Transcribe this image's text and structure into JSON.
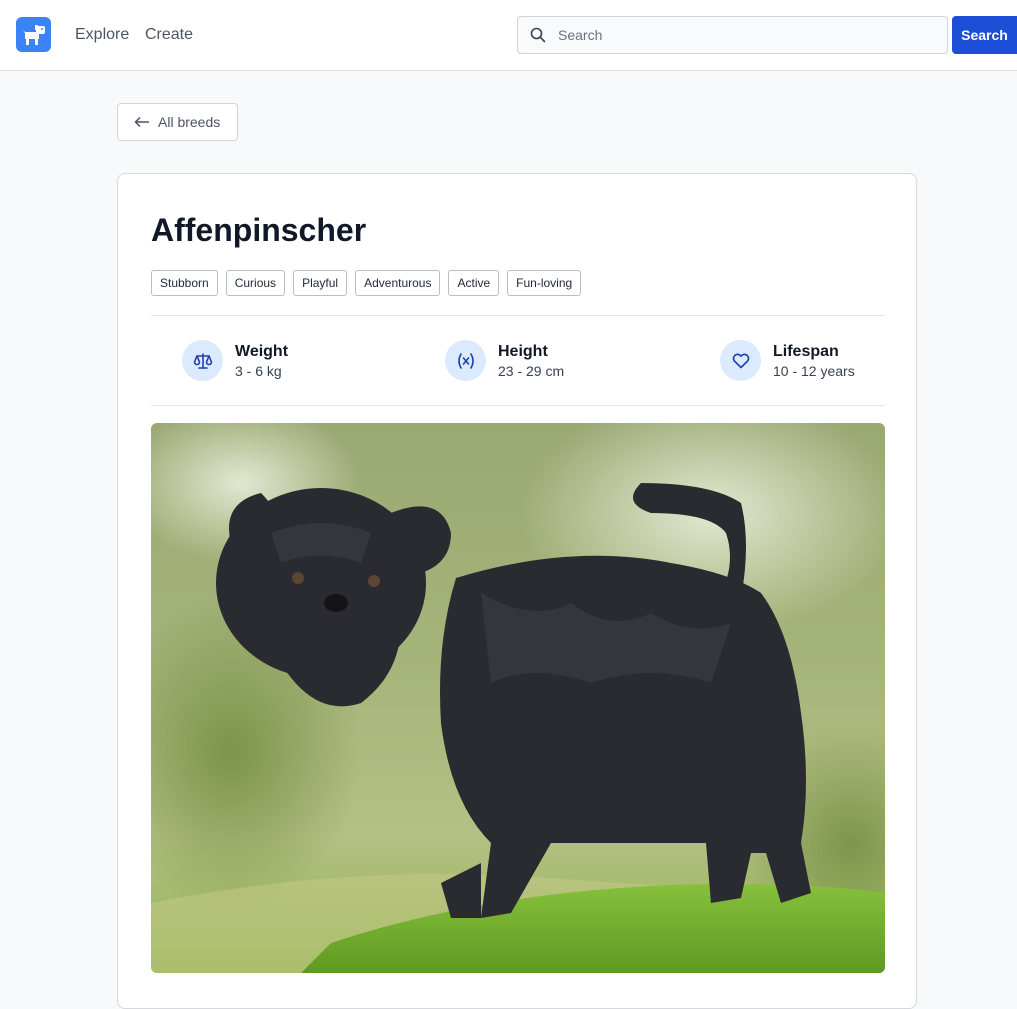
{
  "nav": {
    "logo_icon": "dog-icon",
    "links": [
      "Explore",
      "Create"
    ],
    "search_placeholder": "Search",
    "search_button_label": "Search"
  },
  "back_button": {
    "icon": "arrow-left-icon",
    "label": "All breeds"
  },
  "breed": {
    "name": "Affenpinscher",
    "temperament": [
      "Stubborn",
      "Curious",
      "Playful",
      "Adventurous",
      "Active",
      "Fun-loving"
    ],
    "stats": {
      "weight": {
        "label": "Weight",
        "value": "3 - 6 kg",
        "icon": "scale-icon"
      },
      "height": {
        "label": "Height",
        "value": "23 - 29 cm",
        "icon": "variable-icon"
      },
      "lifespan": {
        "label": "Lifespan",
        "value": "10 - 12 years",
        "icon": "heart-icon"
      }
    },
    "photo": "black shaggy Affenpinscher dog standing on grass"
  },
  "colors": {
    "accent": "#1d4ed8",
    "logo": "#3b82f6",
    "stat_icon_bg": "#dbeafe"
  }
}
